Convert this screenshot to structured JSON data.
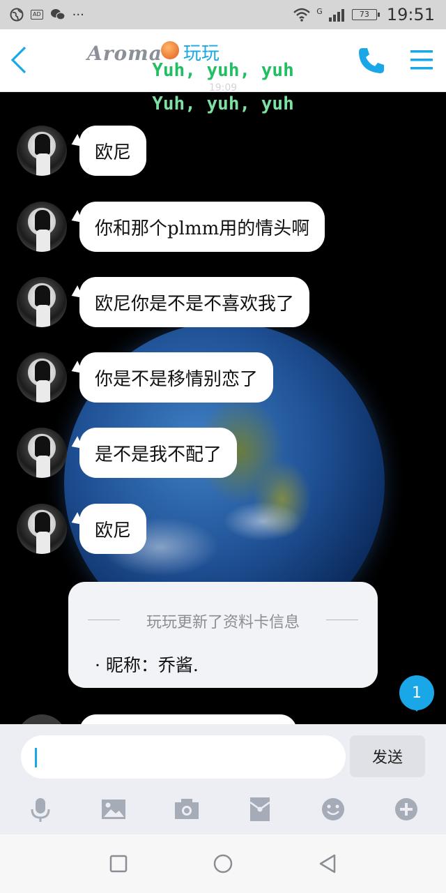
{
  "status_bar": {
    "time": "19:51",
    "battery": "73",
    "network": "G",
    "ad_badge": "AD",
    "more": "···",
    "icons": [
      "globe-icon",
      "ad-icon",
      "wechat-icon",
      "wifi-icon",
      "signal-icon",
      "battery-icon"
    ]
  },
  "header": {
    "brand": "Aroma",
    "contact_name": "玩玩",
    "lyric_1": "Yuh, yuh, yuh",
    "lyric_2": "Yuh, yuh, yuh",
    "ghost_time": "19:09",
    "accent_color": "#1aa7e8"
  },
  "messages": [
    {
      "text": "欧尼"
    },
    {
      "text": "你和那个plmm用的情头啊"
    },
    {
      "text": "欧尼你是不是不喜欢我了"
    },
    {
      "text": "你是不是移情别恋了"
    },
    {
      "text": "是不是我不配了"
    },
    {
      "text": "欧尼"
    }
  ],
  "system_card": {
    "title": "玩玩更新了资料卡信息",
    "detail": "·  昵称：乔酱."
  },
  "unread_count": "1",
  "input": {
    "value": "",
    "send_label": "发送"
  },
  "toolbar_icons": [
    "microphone-icon",
    "image-icon",
    "camera-icon",
    "red-packet-icon",
    "emoji-icon",
    "plus-icon"
  ],
  "nav_icons": [
    "recents-icon",
    "home-icon",
    "back-icon"
  ]
}
